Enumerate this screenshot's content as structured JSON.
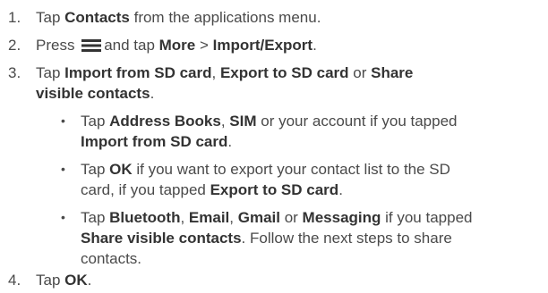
{
  "steps": [
    {
      "num": "1.",
      "pre": "Tap ",
      "b1": "Contacts",
      "post": " from the applications menu."
    },
    {
      "num": "2.",
      "pre": "Press ",
      "icon": "menu-icon",
      "mid": "and tap ",
      "b1": "More",
      "sep": " > ",
      "b2": "Import/Export",
      "end": "."
    },
    {
      "num": "3.",
      "pre": "Tap ",
      "b1": "Import from SD card",
      "sep1": ", ",
      "b2": "Export to SD card",
      "sep2": " or ",
      "b3": "Share",
      "b3cont": "visible contacts",
      "end": "."
    },
    {
      "num": "4.",
      "pre": "Tap ",
      "b1": "OK",
      "end": "."
    }
  ],
  "bullets": [
    {
      "symbol": "•",
      "l1_pre": "Tap ",
      "l1_b1": "Address Books",
      "l1_sep": ", ",
      "l1_b2": "SIM",
      "l1_post": " or your account if you tapped",
      "l2_b": "Import from SD card",
      "l2_end": "."
    },
    {
      "symbol": "•",
      "l1_pre": "Tap ",
      "l1_b1": "OK",
      "l1_post": " if you want to export your contact list to the SD",
      "l2_pre": "card, if you tapped ",
      "l2_b": "Export to SD card",
      "l2_end": "."
    },
    {
      "symbol": "•",
      "l1_pre": "Tap ",
      "l1_b1": "Bluetooth",
      "l1_sep1": ", ",
      "l1_b2": "Email",
      "l1_sep2": ", ",
      "l1_b3": "Gmail",
      "l1_sep3": " or ",
      "l1_b4": "Messaging",
      "l1_post": " if you tapped",
      "l2_b": "Share visible contacts",
      "l2_post": ". Follow the next steps to share",
      "l3": "contacts."
    }
  ],
  "colors": {
    "text": "#4a4a4a",
    "bold": "#333333"
  }
}
